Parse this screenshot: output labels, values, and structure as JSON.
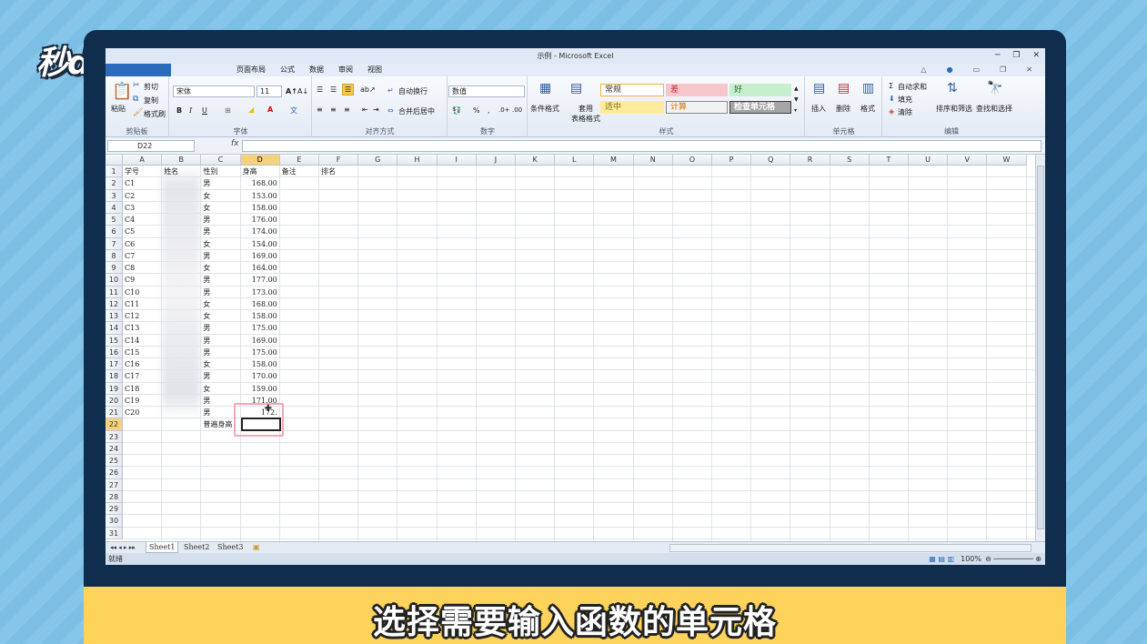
{
  "logo": "秒d ng视频",
  "caption": "选择需要输入函数的单元格",
  "window": {
    "title": "示例 - Microsoft Excel"
  },
  "menu": [
    "",
    "开始",
    "插入",
    "页面布局",
    "公式",
    "数据",
    "审阅",
    "视图"
  ],
  "ribbon": {
    "clipboard": {
      "paste": "粘贴",
      "cut": "剪切",
      "copy": "复制",
      "format_painter": "格式刷",
      "label": "剪贴板"
    },
    "font": {
      "name": "宋体",
      "size": "11",
      "bold": "B",
      "italic": "I",
      "underline": "U",
      "label": "字体"
    },
    "align": {
      "wrap": "自动换行",
      "merge": "合并后居中",
      "label": "对齐方式"
    },
    "number": {
      "format": "数值",
      "percent": "%",
      "comma": ",",
      "label": "数字"
    },
    "styles": {
      "cond": "条件格式",
      "table": "套用\n表格格式",
      "label": "样式",
      "cells": [
        {
          "text": "常规",
          "bg": "#ffffff",
          "color": "#333333",
          "border": "#f2b23c"
        },
        {
          "text": "差",
          "bg": "#f7c6cb",
          "color": "#b0303a",
          "border": "#f7c6cb"
        },
        {
          "text": "好",
          "bg": "#c6efce",
          "color": "#2a6b31",
          "border": "#c6efce"
        },
        {
          "text": "适中",
          "bg": "#ffeb9c",
          "color": "#8a6d10",
          "border": "#ffeb9c"
        },
        {
          "text": "计算",
          "bg": "#f2f2f2",
          "color": "#d4740b",
          "border": "#8c8c8c"
        },
        {
          "text": "检查单元格",
          "bg": "#a5a5a5",
          "color": "#ffffff",
          "border": "#3f3f3f"
        }
      ]
    },
    "cells": {
      "insert": "插入",
      "delete": "删除",
      "format": "格式",
      "label": "单元格"
    },
    "edit": {
      "autosum": "自动求和",
      "fill": "填充",
      "clear": "清除",
      "sort": "排序和筛选",
      "find": "查找和选择",
      "label": "编辑"
    }
  },
  "formula_bar": {
    "name_box": "D22",
    "fx": "fx",
    "value": ""
  },
  "columns": [
    "A",
    "B",
    "C",
    "D",
    "E",
    "F",
    "G",
    "H",
    "I",
    "J",
    "K",
    "L",
    "M",
    "N",
    "O",
    "P",
    "Q",
    "R",
    "S",
    "T",
    "U",
    "V",
    "W"
  ],
  "selected_column": "D",
  "selected_row": 22,
  "rows": [
    [
      "学号",
      "姓名",
      "性别",
      "身高",
      "备注",
      "排名"
    ],
    [
      "C1",
      "",
      "男",
      "168.00",
      "",
      ""
    ],
    [
      "C2",
      "",
      "女",
      "153.00",
      "",
      ""
    ],
    [
      "C3",
      "",
      "女",
      "158.00",
      "",
      ""
    ],
    [
      "C4",
      "",
      "男",
      "176.00",
      "",
      ""
    ],
    [
      "C5",
      "",
      "男",
      "174.00",
      "",
      ""
    ],
    [
      "C6",
      "",
      "女",
      "154.00",
      "",
      ""
    ],
    [
      "C7",
      "",
      "男",
      "169.00",
      "",
      ""
    ],
    [
      "C8",
      "",
      "女",
      "164.00",
      "",
      ""
    ],
    [
      "C9",
      "",
      "男",
      "177.00",
      "",
      ""
    ],
    [
      "C10",
      "",
      "男",
      "173.00",
      "",
      ""
    ],
    [
      "C11",
      "",
      "女",
      "168.00",
      "",
      ""
    ],
    [
      "C12",
      "",
      "女",
      "158.00",
      "",
      ""
    ],
    [
      "C13",
      "",
      "男",
      "175.00",
      "",
      ""
    ],
    [
      "C14",
      "",
      "男",
      "169.00",
      "",
      ""
    ],
    [
      "C15",
      "",
      "男",
      "175.00",
      "",
      ""
    ],
    [
      "C16",
      "",
      "女",
      "158.00",
      "",
      ""
    ],
    [
      "C17",
      "",
      "男",
      "170.00",
      "",
      ""
    ],
    [
      "C18",
      "",
      "女",
      "159.00",
      "",
      ""
    ],
    [
      "C19",
      "",
      "男",
      "171.00",
      "",
      ""
    ],
    [
      "C20",
      "",
      "男",
      "172.",
      "",
      ""
    ],
    [
      "",
      "",
      "普遍身高",
      "",
      "",
      ""
    ]
  ],
  "row_count": 31,
  "sheets": [
    "Sheet1",
    "Sheet2",
    "Sheet3"
  ],
  "status": {
    "ready": "就绪",
    "zoom": "100%"
  }
}
